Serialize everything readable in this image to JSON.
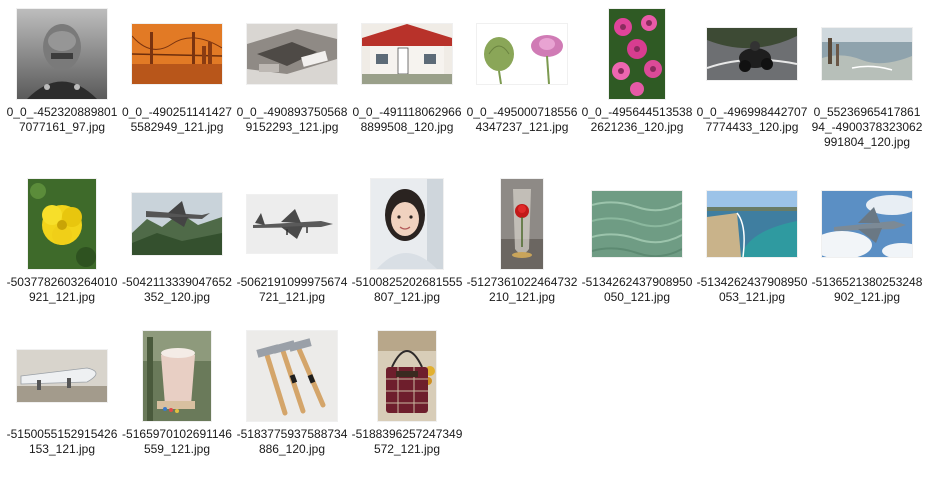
{
  "files": [
    {
      "name": "0_0_-4523208898017077161_97.jpg",
      "icon": "portrait-photo-thumbnail"
    },
    {
      "name": "0_0_-4902511414275582949_121.jpg",
      "icon": "bridge-photo-thumbnail"
    },
    {
      "name": "0_0_-4908937505689152293_121.jpg",
      "icon": "machinery-photo-thumbnail"
    },
    {
      "name": "0_0_-4911180629668899508_120.jpg",
      "icon": "house-photo-thumbnail"
    },
    {
      "name": "0_0_-4950007185564347237_121.jpg",
      "icon": "poppy-photo-thumbnail"
    },
    {
      "name": "0_0_-4956445135382621236_120.jpg",
      "icon": "flowers-photo-thumbnail"
    },
    {
      "name": "0_0_-4969984427077774433_120.jpg",
      "icon": "motorcycle-photo-thumbnail"
    },
    {
      "name": "0_55236965417861 94_-4900378323062991804_120.jpg",
      "icon": "coast-photo-thumbnail"
    },
    {
      "name": "-5037782603264010921_121.jpg",
      "icon": "yellow-flower-photo-thumbnail"
    },
    {
      "name": "-5042113339047652352_120.jpg",
      "icon": "jet-photo-thumbnail"
    },
    {
      "name": "-5062191099975674721_121.jpg",
      "icon": "fighter-jet-photo-thumbnail"
    },
    {
      "name": "-5100825202681555807_121.jpg",
      "icon": "woman-photo-thumbnail"
    },
    {
      "name": "-5127361022464732210_121.jpg",
      "icon": "rose-vase-photo-thumbnail"
    },
    {
      "name": "-5134262437908950050_121.jpg",
      "icon": "water-photo-thumbnail"
    },
    {
      "name": "-5134262437908950053_121.jpg",
      "icon": "beach-photo-thumbnail"
    },
    {
      "name": "-5136521380253248902_121.jpg",
      "icon": "fighter-sky-photo-thumbnail"
    },
    {
      "name": "-5150055152915426153_121.jpg",
      "icon": "missile-photo-thumbnail"
    },
    {
      "name": "-5165970102691146559_121.jpg",
      "icon": "cup-photo-thumbnail"
    },
    {
      "name": "-5183775937588734886_120.jpg",
      "icon": "hammers-photo-thumbnail"
    },
    {
      "name": "-5188396257247349572_121.jpg",
      "icon": "handbag-photo-thumbnail"
    }
  ]
}
